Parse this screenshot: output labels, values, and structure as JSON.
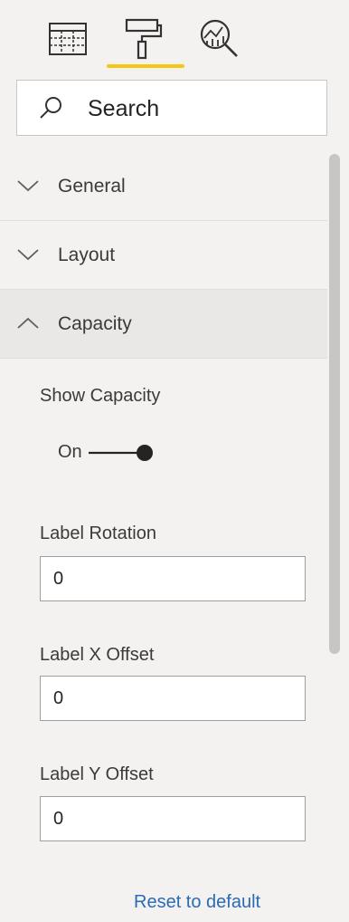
{
  "toolbar": {
    "tabs": [
      {
        "name": "fields",
        "icon": "fields-icon"
      },
      {
        "name": "format",
        "icon": "paint-roller-icon",
        "active": true
      },
      {
        "name": "analytics",
        "icon": "analytics-icon"
      }
    ],
    "accent_color": "#f2c811"
  },
  "search": {
    "placeholder": "Search",
    "icon": "search-icon"
  },
  "sections": [
    {
      "title": "General",
      "expanded": false
    },
    {
      "title": "Layout",
      "expanded": false
    },
    {
      "title": "Capacity",
      "expanded": true
    }
  ],
  "capacity": {
    "show_capacity_label": "Show Capacity",
    "toggle_state": "On",
    "label_rotation": {
      "label": "Label Rotation",
      "value": "0"
    },
    "label_x_offset": {
      "label": "Label X Offset",
      "value": "0"
    },
    "label_y_offset": {
      "label": "Label Y Offset",
      "value": "0"
    }
  },
  "footer": {
    "reset_label": "Reset to default",
    "link_color": "#2b6bb5"
  }
}
